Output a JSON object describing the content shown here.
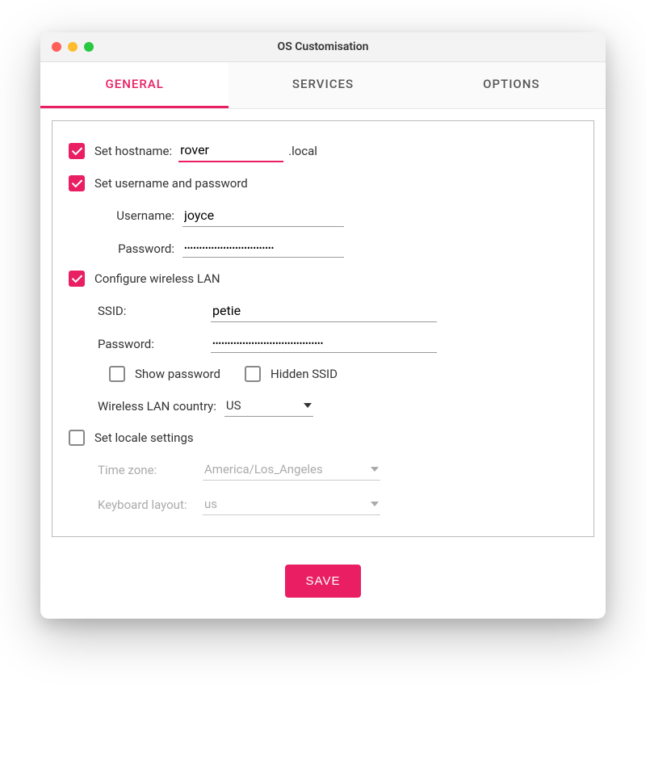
{
  "window": {
    "title": "OS Customisation"
  },
  "tabs": {
    "general": "GENERAL",
    "services": "SERVICES",
    "options": "OPTIONS"
  },
  "hostname": {
    "checkbox_label": "Set hostname:",
    "value": "rover",
    "suffix": ".local"
  },
  "userpass": {
    "checkbox_label": "Set username and password",
    "username_label": "Username:",
    "username_value": "joyce",
    "password_label": "Password:",
    "password_value": "••••••••••••••••••••••••••••••"
  },
  "wlan": {
    "checkbox_label": "Configure wireless LAN",
    "ssid_label": "SSID:",
    "ssid_value": "petie",
    "password_label": "Password:",
    "password_value": "•••••••••••••••••••••••••••••••••••••",
    "show_password_label": "Show password",
    "hidden_ssid_label": "Hidden SSID",
    "country_label": "Wireless LAN country:",
    "country_value": "US"
  },
  "locale": {
    "checkbox_label": "Set locale settings",
    "timezone_label": "Time zone:",
    "timezone_value": "America/Los_Angeles",
    "keyboard_label": "Keyboard layout:",
    "keyboard_value": "us"
  },
  "footer": {
    "save_label": "SAVE"
  }
}
